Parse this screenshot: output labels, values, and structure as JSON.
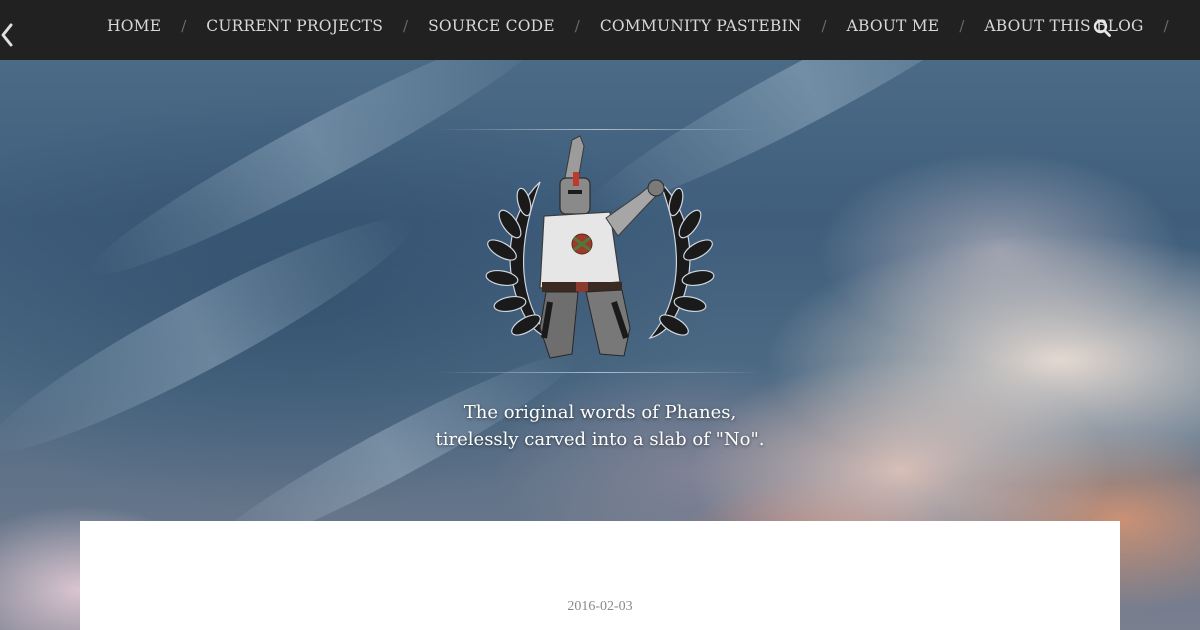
{
  "nav": {
    "items": [
      {
        "label": "HOME"
      },
      {
        "label": "CURRENT PROJECTS"
      },
      {
        "label": "SOURCE CODE"
      },
      {
        "label": "COMMUNITY PASTEBIN"
      },
      {
        "label": "ABOUT ME"
      },
      {
        "label": "ABOUT THIS BLOG"
      }
    ],
    "separator": "/",
    "icons": {
      "back": "chevron-left-icon",
      "search": "search-icon"
    }
  },
  "header": {
    "tagline_line1": "The original words of Phanes,",
    "tagline_line2": "tirelessly carved into a slab of \"No\".",
    "emblem_icon": "knight-laurel-emblem"
  },
  "post": {
    "date": "2016-02-03"
  },
  "colors": {
    "topbar": "#212121",
    "nav_text": "#d8d8d8",
    "card": "#ffffff",
    "date_text": "#8a8a8a"
  }
}
